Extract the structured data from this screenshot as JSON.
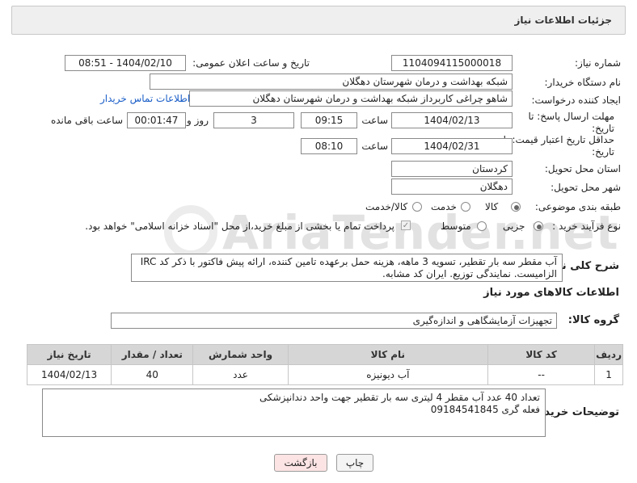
{
  "header": {
    "title": "جزئیات اطلاعات نیاز"
  },
  "form": {
    "need_number_label": "شماره نیاز:",
    "need_number": "1104094115000018",
    "announce_label": "تاریخ و ساعت اعلان عمومی:",
    "announce_value": "1404/02/10 - 08:51",
    "buyer_label": "نام دستگاه خریدار:",
    "buyer_value": "شبکه بهداشت و درمان شهرستان دهگلان",
    "creator_label": "ایجاد کننده درخواست:",
    "creator_value": "شاهو چراغی کاربرداز شبکه بهداشت و درمان شهرستان دهگلان",
    "contact_link": "اطلاعات تماس خریدار",
    "deadline_label": "مهلت ارسال پاسخ: تا تاریخ:",
    "deadline_date": "1404/02/13",
    "time_label": "ساعت",
    "deadline_time": "09:15",
    "days_value": "3",
    "days_label": "روز و",
    "remaining_value": "00:01:47",
    "remaining_label": "ساعت باقی مانده",
    "validity_label": "حداقل تاریخ اعتبار قیمت: تا تاریخ:",
    "validity_date": "1404/02/31",
    "validity_time_label": "ساعت",
    "validity_time": "08:10",
    "province_label": "استان محل تحویل:",
    "province_value": "کردستان",
    "city_label": "شهر محل تحویل:",
    "city_value": "دهگلان",
    "category_label": "طبقه بندی موضوعی:",
    "category_options": [
      "کالا",
      "خدمت",
      "کالا/خدمت"
    ],
    "category_selected": "کالا",
    "process_label": "نوع فرآیند خرید :",
    "process_options": [
      "جزیی",
      "متوسط"
    ],
    "process_selected": "جزیی",
    "payment_note": "پرداخت تمام یا بخشی از مبلغ خرید،از محل \"اسناد خزانه اسلامی\" خواهد بود."
  },
  "description": {
    "label": "شرح کلی نیاز:",
    "text": "آب مقطر سه بار تقطیر، تسویه 3 ماهه، هزینه حمل برعهده تامین کننده، ارائه پیش فاکتور با ذکر کد IRC الزامیست. نمایندگی توزیع. ایران کد مشابه."
  },
  "goods": {
    "section_title": "اطلاعات کالاهای مورد نیاز",
    "group_label": "گروه کالا:",
    "group_value": "تجهیزات آزمایشگاهی و اندازه‌گیری",
    "columns": [
      "ردیف",
      "کد کالا",
      "نام کالا",
      "واحد شمارش",
      "تعداد / مقدار",
      "تاریخ نیاز"
    ],
    "rows": [
      {
        "row": "1",
        "code": "--",
        "name": "آب دیونیزه",
        "unit": "عدد",
        "qty": "40",
        "date": "1404/02/13"
      }
    ]
  },
  "buyer_notes": {
    "label": "توضیحات خریدار:",
    "line1": "تعداد 40 عدد آب مقطر 4 لیتری سه بار تقطیر جهت واحد دندانپزشکی",
    "line2": "فعله گری 09184541845"
  },
  "buttons": {
    "print": "چاپ",
    "back": "بازگشت"
  },
  "watermark": {
    "text": "AriaTender.net"
  },
  "colors": {
    "link": "#1a5ec8",
    "header_bg": "#efefef",
    "back_button_bg": "#fde4e4"
  }
}
